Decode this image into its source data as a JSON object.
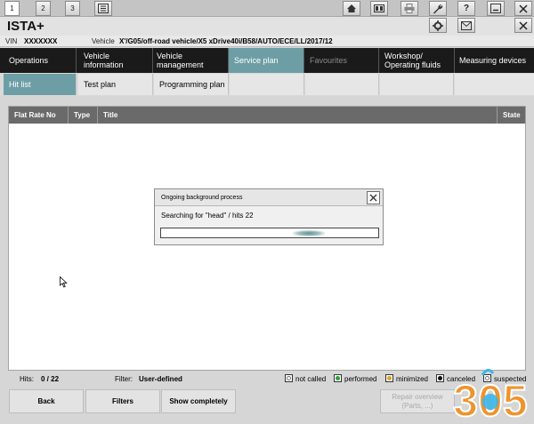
{
  "toolbar": {
    "screen_buttons": [
      "1",
      "2",
      "3"
    ],
    "icons": [
      "list-icon",
      "home-icon",
      "data-icon",
      "print-icon",
      "wrench-icon",
      "help-icon",
      "minimize-icon",
      "close-icon"
    ],
    "row2_icons": [
      "settings-icon",
      "mail-icon",
      "close-icon"
    ]
  },
  "app": {
    "title": "ISTA+"
  },
  "vehicle": {
    "vin_label": "VIN",
    "vin_value": "XXXXXXX",
    "vehicle_label": "Vehicle",
    "vehicle_value": "X'/G05/off-road vehicle/X5 xDrive40i/B58/AUTO/ECE/LL/2017/12"
  },
  "main_tabs": [
    {
      "label": "Operations",
      "state": "normal"
    },
    {
      "label": "Vehicle information",
      "state": "normal"
    },
    {
      "label": "Vehicle management",
      "state": "normal"
    },
    {
      "label": "Service plan",
      "state": "active"
    },
    {
      "label": "Favourites",
      "state": "disabled"
    },
    {
      "label": "Workshop/ Operating fluids",
      "state": "normal"
    },
    {
      "label": "Measuring devices",
      "state": "normal"
    }
  ],
  "sub_tabs": [
    {
      "label": "Hit list",
      "state": "active"
    },
    {
      "label": "Test plan",
      "state": "normal"
    },
    {
      "label": "Programming plan",
      "state": "normal"
    }
  ],
  "table": {
    "columns": [
      "Flat Rate No",
      "Type",
      "Title",
      "State"
    ]
  },
  "dialog": {
    "title": "Ongoing background process",
    "message": "Searching for \"head\" / hits 22"
  },
  "status": {
    "hits_label": "Hits:",
    "hits_value": "0 / 22",
    "filter_label": "Filter:",
    "filter_value": "User-defined"
  },
  "legend": [
    {
      "label": "not called",
      "color": "#ffffff"
    },
    {
      "label": "performed",
      "color": "#2e9e3c"
    },
    {
      "label": "minimized",
      "color": "#d9a32b"
    },
    {
      "label": "canceled",
      "color": "#111111"
    },
    {
      "label": "suspected",
      "color": "#ffffff"
    }
  ],
  "buttons": {
    "back": "Back",
    "filters": "Filters",
    "show_completely": "Show completely",
    "repair_overview_line1": "Repair overview",
    "repair_overview_line2": "(Parts, ...)"
  },
  "watermark": {
    "text": "305"
  },
  "colors": {
    "accent": "#6e9ea5",
    "tab_bar": "#1a1a1a",
    "table_header": "#6a6a6a"
  }
}
